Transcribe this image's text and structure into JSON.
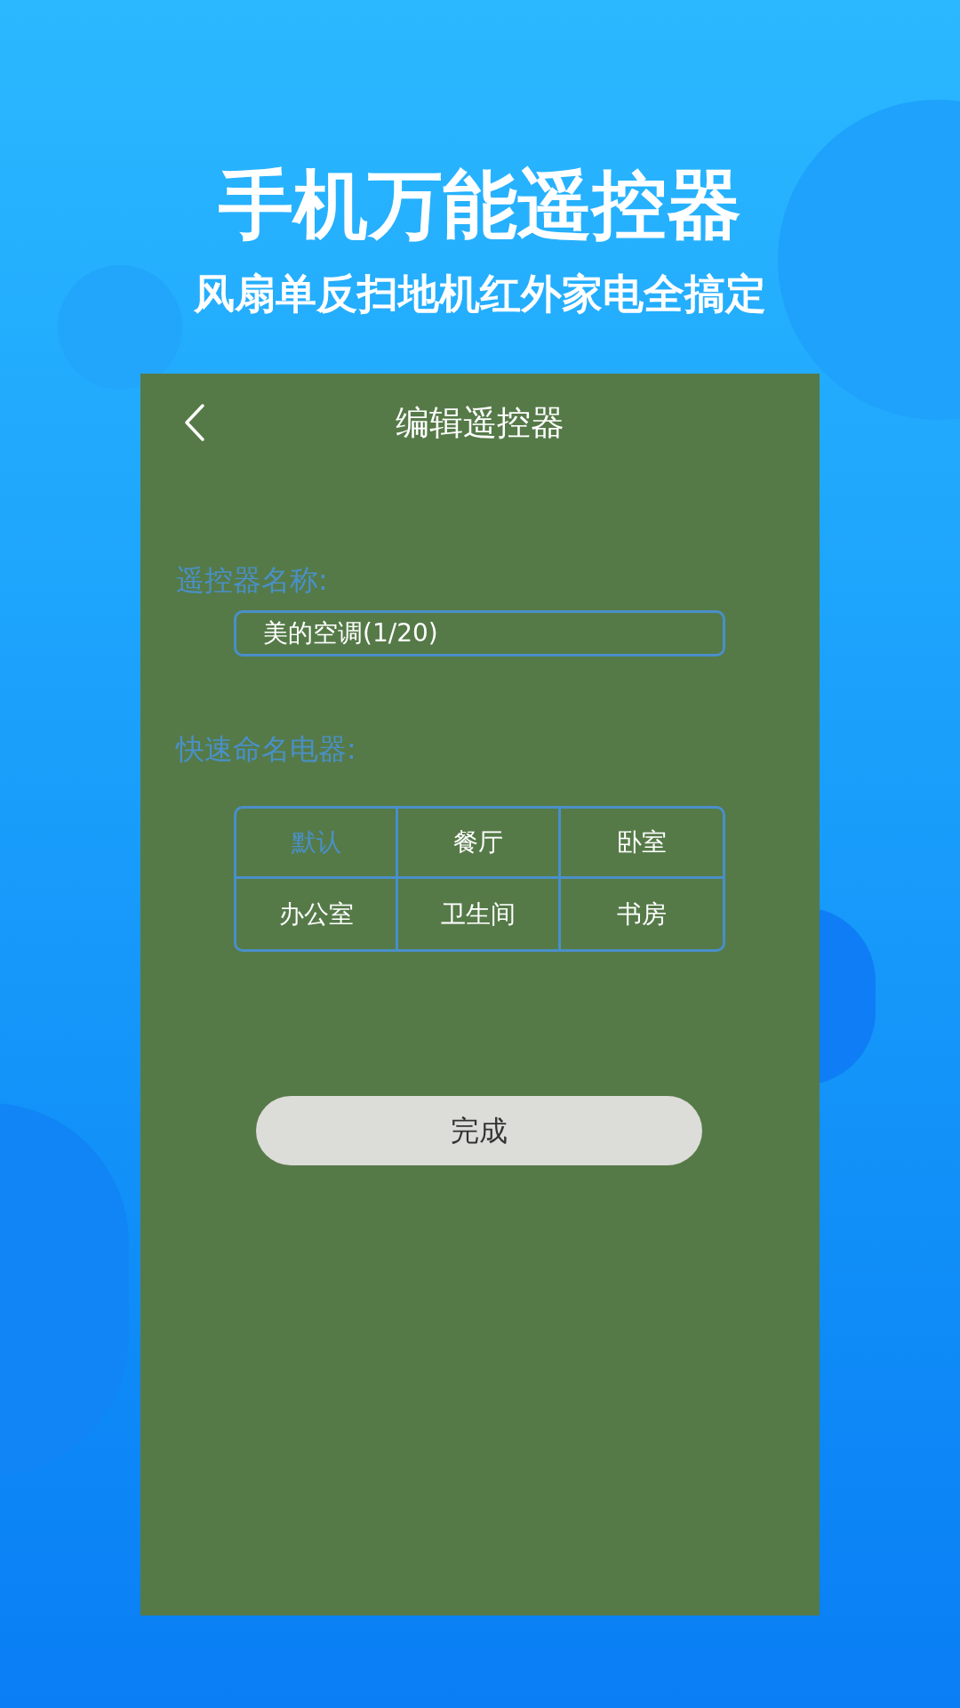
{
  "headline": "手机万能遥控器",
  "subheadline": "风扇单反扫地机红外家电全搞定",
  "screen": {
    "title": "编辑遥控器",
    "name_label": "遥控器名称:",
    "name_field": {
      "value": "美的空调(1/20)"
    },
    "quick_label": "快速命名电器:",
    "quick_names": [
      {
        "label": "默认",
        "selected": true
      },
      {
        "label": "餐厅",
        "selected": false
      },
      {
        "label": "卧室",
        "selected": false
      },
      {
        "label": "办公室",
        "selected": false
      },
      {
        "label": "卫生间",
        "selected": false
      },
      {
        "label": "书房",
        "selected": false
      }
    ],
    "done_button": "完成"
  }
}
